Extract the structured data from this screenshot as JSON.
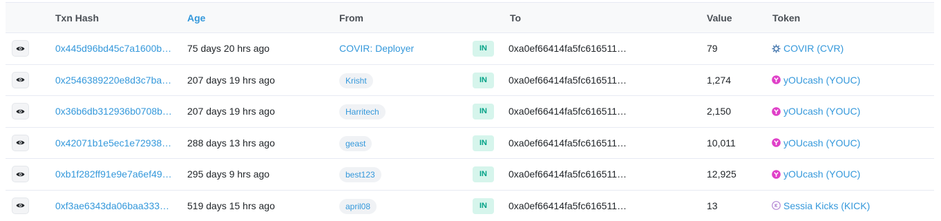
{
  "headers": {
    "txn_hash": "Txn Hash",
    "age": "Age",
    "from": "From",
    "to": "To",
    "value": "Value",
    "token": "Token"
  },
  "rows": [
    {
      "hash": "0x445d96bd45c7a1600b…",
      "age": "75 days 20 hrs ago",
      "from": "COVIR: Deployer",
      "from_style": "link",
      "direction": "IN",
      "to": "0xa0ef66414fa5fc616511…",
      "value": "79",
      "token": "COVIR (CVR)",
      "token_icon": "covir-gear-icon"
    },
    {
      "hash": "0x2546389220e8d3c7ba…",
      "age": "207 days 19 hrs ago",
      "from": "Krisht",
      "from_style": "badge",
      "direction": "IN",
      "to": "0xa0ef66414fa5fc616511…",
      "value": "1,274",
      "token": "yOUcash (YOUC)",
      "token_icon": "youcash-icon"
    },
    {
      "hash": "0x36b6db312936b0708b…",
      "age": "207 days 19 hrs ago",
      "from": "Harritech",
      "from_style": "badge",
      "direction": "IN",
      "to": "0xa0ef66414fa5fc616511…",
      "value": "2,150",
      "token": "yOUcash (YOUC)",
      "token_icon": "youcash-icon"
    },
    {
      "hash": "0x42071b1e5ec1e72938…",
      "age": "288 days 13 hrs ago",
      "from": "geast",
      "from_style": "badge",
      "direction": "IN",
      "to": "0xa0ef66414fa5fc616511…",
      "value": "10,011",
      "token": "yOUcash (YOUC)",
      "token_icon": "youcash-icon"
    },
    {
      "hash": "0xb1f282ff91e9e7a6ef49…",
      "age": "295 days 9 hrs ago",
      "from": "best123",
      "from_style": "badge",
      "direction": "IN",
      "to": "0xa0ef66414fa5fc616511…",
      "value": "12,925",
      "token": "yOUcash (YOUC)",
      "token_icon": "youcash-icon"
    },
    {
      "hash": "0xf3ae6343da06baa333…",
      "age": "519 days 15 hrs ago",
      "from": "april08",
      "from_style": "badge",
      "direction": "IN",
      "to": "0xa0ef66414fa5fc616511…",
      "value": "13",
      "token": "Sessia Kicks (KICK)",
      "token_icon": "sessia-kicks-icon"
    }
  ],
  "colors": {
    "link": "#3498db",
    "in_badge_bg": "#d6f5ec",
    "in_badge_text": "#00a186",
    "youcash_pink": "#e040c8",
    "covir_blue": "#4a7bb0",
    "sessia_purple": "#b58ad6"
  }
}
